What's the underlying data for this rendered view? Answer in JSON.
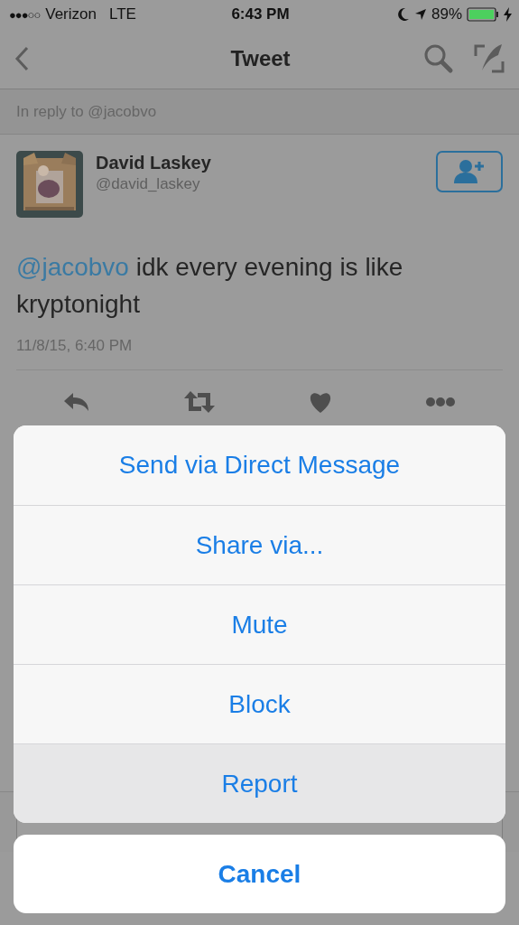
{
  "status_bar": {
    "signal": "●●●○○",
    "carrier": "Verizon",
    "network": "LTE",
    "time": "6:43 PM",
    "battery": "89%"
  },
  "nav": {
    "title": "Tweet"
  },
  "reply_context": "In reply to @jacobvo",
  "tweet": {
    "name": "David Laskey",
    "handle": "@david_laskey",
    "mention": "@jacobvo",
    "text": "idk every evening is like kryptonight",
    "timestamp": "11/8/15, 6:40 PM"
  },
  "action_sheet": {
    "actions": [
      {
        "label": "Send via Direct Message",
        "selected": false
      },
      {
        "label": "Share via...",
        "selected": false
      },
      {
        "label": "Mute",
        "selected": false
      },
      {
        "label": "Block",
        "selected": false
      },
      {
        "label": "Report",
        "selected": true
      }
    ],
    "cancel": "Cancel"
  }
}
